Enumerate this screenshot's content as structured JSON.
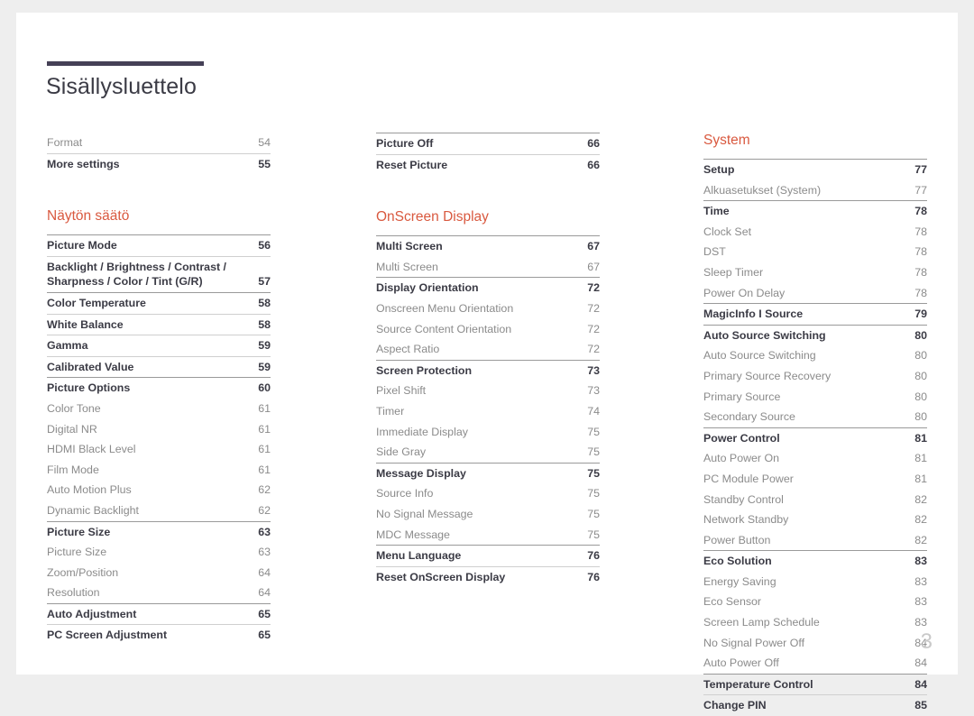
{
  "document": {
    "title": "Sisällysluettelo",
    "folio": "3",
    "accent_color": "#d9593f",
    "title_bar_color": "#454056"
  },
  "columns": [
    {
      "name": "column-1",
      "blocks": [
        {
          "type": "group",
          "rule": "none",
          "rows": [
            {
              "style": "sub",
              "label": "Format",
              "page": "54"
            }
          ]
        },
        {
          "type": "group",
          "rule": "light",
          "rows": [
            {
              "style": "main",
              "label": "More settings",
              "page": "55"
            }
          ]
        },
        {
          "type": "section",
          "heading": "Näytön säätö"
        },
        {
          "type": "group",
          "rule": "solid",
          "rows": [
            {
              "style": "main",
              "label": "Picture Mode",
              "page": "56"
            }
          ]
        },
        {
          "type": "group",
          "rule": "light",
          "rows": [
            {
              "style": "main",
              "wrap": true,
              "label": "Backlight / Brightness / Contrast / Sharpness / Color / Tint (G/R)",
              "page": "57"
            }
          ]
        },
        {
          "type": "group",
          "rule": "solid",
          "rows": [
            {
              "style": "main",
              "label": "Color Temperature",
              "page": "58"
            }
          ]
        },
        {
          "type": "group",
          "rule": "light",
          "rows": [
            {
              "style": "main",
              "label": "White Balance",
              "page": "58"
            }
          ]
        },
        {
          "type": "group",
          "rule": "light",
          "rows": [
            {
              "style": "main",
              "label": "Gamma",
              "page": "59"
            }
          ]
        },
        {
          "type": "group",
          "rule": "light",
          "rows": [
            {
              "style": "main",
              "label": "Calibrated Value",
              "page": "59"
            }
          ]
        },
        {
          "type": "group",
          "rule": "solid",
          "rows": [
            {
              "style": "main",
              "label": "Picture Options",
              "page": "60"
            },
            {
              "style": "sub",
              "label": "Color Tone",
              "page": "61"
            },
            {
              "style": "sub",
              "label": "Digital NR",
              "page": "61"
            },
            {
              "style": "sub",
              "label": "HDMI Black Level",
              "page": "61"
            },
            {
              "style": "sub",
              "label": "Film Mode",
              "page": "61"
            },
            {
              "style": "sub",
              "label": "Auto Motion Plus",
              "page": "62"
            },
            {
              "style": "sub",
              "label": "Dynamic Backlight",
              "page": "62"
            }
          ]
        },
        {
          "type": "group",
          "rule": "solid",
          "rows": [
            {
              "style": "main",
              "label": "Picture Size",
              "page": "63"
            },
            {
              "style": "sub",
              "label": "Picture Size",
              "page": "63"
            },
            {
              "style": "sub",
              "label": "Zoom/Position",
              "page": "64"
            },
            {
              "style": "sub",
              "label": "Resolution",
              "page": "64"
            }
          ]
        },
        {
          "type": "group",
          "rule": "solid",
          "rows": [
            {
              "style": "main",
              "label": "Auto Adjustment",
              "page": "65"
            }
          ]
        },
        {
          "type": "group",
          "rule": "light",
          "rows": [
            {
              "style": "main",
              "label": "PC Screen Adjustment",
              "page": "65"
            }
          ]
        }
      ]
    },
    {
      "name": "column-2",
      "blocks": [
        {
          "type": "group",
          "rule": "solid",
          "rows": [
            {
              "style": "main",
              "label": "Picture Off",
              "page": "66"
            }
          ]
        },
        {
          "type": "group",
          "rule": "light",
          "rows": [
            {
              "style": "main",
              "label": "Reset Picture",
              "page": "66"
            }
          ]
        },
        {
          "type": "section",
          "heading": "OnScreen Display"
        },
        {
          "type": "group",
          "rule": "solid",
          "rows": [
            {
              "style": "main",
              "label": "Multi Screen",
              "page": "67"
            },
            {
              "style": "sub",
              "label": "Multi Screen",
              "page": "67"
            }
          ]
        },
        {
          "type": "group",
          "rule": "solid",
          "rows": [
            {
              "style": "main",
              "label": "Display Orientation",
              "page": "72"
            },
            {
              "style": "sub",
              "label": "Onscreen Menu Orientation",
              "page": "72"
            },
            {
              "style": "sub",
              "label": "Source Content Orientation",
              "page": "72"
            },
            {
              "style": "sub",
              "label": "Aspect Ratio",
              "page": "72"
            }
          ]
        },
        {
          "type": "group",
          "rule": "solid",
          "rows": [
            {
              "style": "main",
              "label": "Screen Protection",
              "page": "73"
            },
            {
              "style": "sub",
              "label": "Pixel Shift",
              "page": "73"
            },
            {
              "style": "sub",
              "label": "Timer",
              "page": "74"
            },
            {
              "style": "sub",
              "label": "Immediate Display",
              "page": "75"
            },
            {
              "style": "sub",
              "label": "Side Gray",
              "page": "75"
            }
          ]
        },
        {
          "type": "group",
          "rule": "solid",
          "rows": [
            {
              "style": "main",
              "label": "Message Display",
              "page": "75"
            },
            {
              "style": "sub",
              "label": "Source Info",
              "page": "75"
            },
            {
              "style": "sub",
              "label": "No Signal Message",
              "page": "75"
            },
            {
              "style": "sub",
              "label": "MDC Message",
              "page": "75"
            }
          ]
        },
        {
          "type": "group",
          "rule": "solid",
          "rows": [
            {
              "style": "main",
              "label": "Menu Language",
              "page": "76"
            }
          ]
        },
        {
          "type": "group",
          "rule": "light",
          "rows": [
            {
              "style": "main",
              "label": "Reset OnScreen Display",
              "page": "76"
            }
          ]
        }
      ]
    },
    {
      "name": "column-3",
      "blocks": [
        {
          "type": "section",
          "heading": "System"
        },
        {
          "type": "group",
          "rule": "solid",
          "rows": [
            {
              "style": "main",
              "label": "Setup",
              "page": "77"
            },
            {
              "style": "sub",
              "label": "Alkuasetukset (System)",
              "page": "77"
            }
          ]
        },
        {
          "type": "group",
          "rule": "solid",
          "rows": [
            {
              "style": "main",
              "label": "Time",
              "page": "78"
            },
            {
              "style": "sub",
              "label": "Clock Set",
              "page": "78"
            },
            {
              "style": "sub",
              "label": "DST",
              "page": "78"
            },
            {
              "style": "sub",
              "label": "Sleep Timer",
              "page": "78"
            },
            {
              "style": "sub",
              "label": "Power On Delay",
              "page": "78"
            }
          ]
        },
        {
          "type": "group",
          "rule": "solid",
          "rows": [
            {
              "style": "main",
              "label": "MagicInfo I Source",
              "page": "79"
            }
          ]
        },
        {
          "type": "group",
          "rule": "solid",
          "rows": [
            {
              "style": "main",
              "label": "Auto Source Switching",
              "page": "80"
            },
            {
              "style": "sub",
              "label": "Auto Source Switching",
              "page": "80"
            },
            {
              "style": "sub",
              "label": "Primary Source Recovery",
              "page": "80"
            },
            {
              "style": "sub",
              "label": "Primary Source",
              "page": "80"
            },
            {
              "style": "sub",
              "label": "Secondary Source",
              "page": "80"
            }
          ]
        },
        {
          "type": "group",
          "rule": "solid",
          "rows": [
            {
              "style": "main",
              "label": "Power Control",
              "page": "81"
            },
            {
              "style": "sub",
              "label": "Auto Power On",
              "page": "81"
            },
            {
              "style": "sub",
              "label": "PC Module Power",
              "page": "81"
            },
            {
              "style": "sub",
              "label": "Standby Control",
              "page": "82"
            },
            {
              "style": "sub",
              "label": "Network Standby",
              "page": "82"
            },
            {
              "style": "sub",
              "label": "Power Button",
              "page": "82"
            }
          ]
        },
        {
          "type": "group",
          "rule": "solid",
          "rows": [
            {
              "style": "main",
              "label": "Eco Solution",
              "page": "83"
            },
            {
              "style": "sub",
              "label": "Energy Saving",
              "page": "83"
            },
            {
              "style": "sub",
              "label": "Eco Sensor",
              "page": "83"
            },
            {
              "style": "sub",
              "label": "Screen Lamp Schedule",
              "page": "83"
            },
            {
              "style": "sub",
              "label": "No Signal Power Off",
              "page": "84"
            },
            {
              "style": "sub",
              "label": "Auto Power Off",
              "page": "84"
            }
          ]
        },
        {
          "type": "group",
          "rule": "solid",
          "rows": [
            {
              "style": "main",
              "label": "Temperature Control",
              "page": "84"
            }
          ]
        },
        {
          "type": "group",
          "rule": "light",
          "rows": [
            {
              "style": "main",
              "label": "Change PIN",
              "page": "85"
            }
          ]
        }
      ]
    }
  ]
}
